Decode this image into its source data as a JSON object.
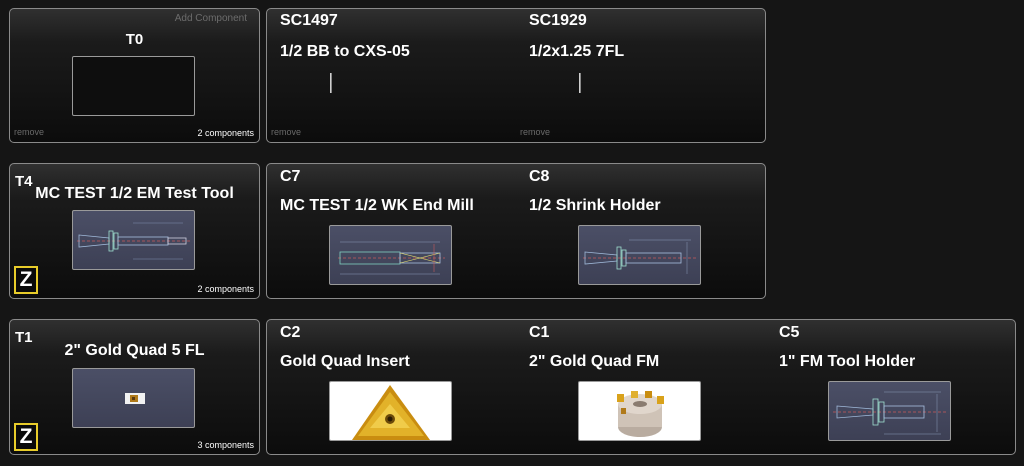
{
  "tools": [
    {
      "id": "T0",
      "name": "",
      "add_label": "Add Component",
      "remove_label": "remove",
      "count_label": "2 components",
      "components": [
        {
          "id": "SC1497",
          "name": "1/2 BB to CXS-05",
          "remove_label": "remove"
        },
        {
          "id": "SC1929",
          "name": "1/2x1.25 7FL",
          "remove_label": "remove"
        }
      ]
    },
    {
      "id": "T4",
      "name": "MC TEST 1/2 EM Test Tool",
      "badge": "Z",
      "count_label": "2 components",
      "components": [
        {
          "id": "C7",
          "name": "MC TEST 1/2 WK End Mill"
        },
        {
          "id": "C8",
          "name": "1/2 Shrink Holder"
        }
      ]
    },
    {
      "id": "T1",
      "name": "2\" Gold Quad 5 FL",
      "badge": "Z",
      "count_label": "3 components",
      "components": [
        {
          "id": "C2",
          "name": "Gold Quad Insert"
        },
        {
          "id": "C1",
          "name": "2\" Gold Quad FM"
        },
        {
          "id": "C5",
          "name": "1\" FM Tool Holder"
        }
      ]
    }
  ],
  "colors": {
    "background": "#151515",
    "panel_border": "#8a8a8a",
    "badge_border": "#e8cc2a",
    "thumb_drawing": "#4b4f66",
    "insert_gold": "#d9a21b"
  }
}
